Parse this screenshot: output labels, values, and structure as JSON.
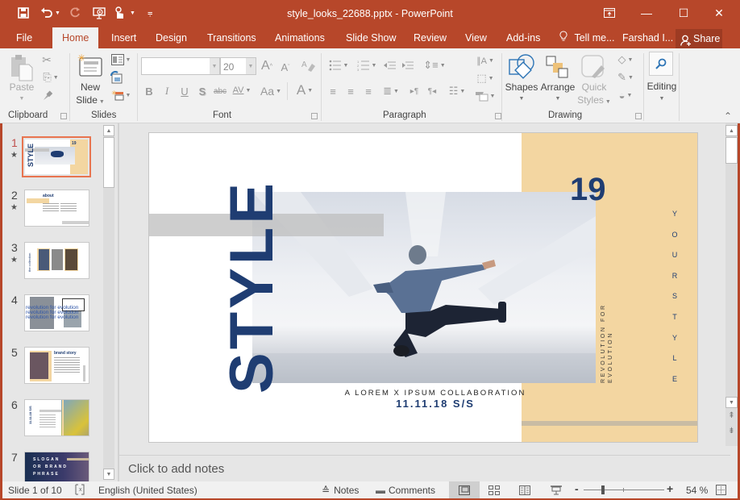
{
  "app": {
    "title": "style_looks_22688.pptx - PowerPoint",
    "accent_color": "#b7472a"
  },
  "quick_access": [
    {
      "name": "save-icon",
      "glyph": "🖫"
    },
    {
      "name": "undo-icon",
      "glyph": "↶"
    },
    {
      "name": "redo-icon",
      "glyph": "↻"
    },
    {
      "name": "start-from-beginning-icon",
      "glyph": "⎚"
    },
    {
      "name": "touch-mode-icon",
      "glyph": "☝"
    },
    {
      "name": "customize-qat-icon",
      "glyph": "⩦"
    }
  ],
  "window_controls": {
    "ribbon_display": "⬒",
    "minimize": "—",
    "maximize": "☐",
    "close": "✕"
  },
  "tabs": [
    {
      "label": "File",
      "active": false
    },
    {
      "label": "Home",
      "active": true
    },
    {
      "label": "Insert",
      "active": false
    },
    {
      "label": "Design",
      "active": false
    },
    {
      "label": "Transitions",
      "active": false
    },
    {
      "label": "Animations",
      "active": false
    },
    {
      "label": "Slide Show",
      "active": false
    },
    {
      "label": "Review",
      "active": false
    },
    {
      "label": "View",
      "active": false
    },
    {
      "label": "Add-ins",
      "active": false
    }
  ],
  "tell_me": "Tell me...",
  "user": "Farshad I...",
  "share": "Share",
  "ribbon": {
    "groups": {
      "clipboard": "Clipboard",
      "slides": "Slides",
      "font": "Font",
      "paragraph": "Paragraph",
      "drawing": "Drawing"
    },
    "paste": "Paste",
    "new_slide": "New",
    "new_slide_2": "Slide",
    "font_name": "",
    "font_size": "20",
    "font_buttons": {
      "bold": "B",
      "italic": "I",
      "underline": "U",
      "shadow": "S",
      "strike": "abc",
      "spacing": "AV",
      "case": "Aa",
      "color": "A",
      "grow": "A",
      "shrink": "A"
    },
    "shapes": "Shapes",
    "arrange": "Arrange",
    "quick": "Quick",
    "styles": "Styles",
    "editing": "Editing"
  },
  "thumbnails": [
    {
      "num": "1",
      "star": true,
      "selected": true
    },
    {
      "num": "2",
      "star": true,
      "selected": false
    },
    {
      "num": "3",
      "star": true,
      "selected": false
    },
    {
      "num": "4",
      "star": false,
      "selected": false
    },
    {
      "num": "5",
      "star": false,
      "selected": false
    },
    {
      "num": "6",
      "star": false,
      "selected": false
    },
    {
      "num": "7",
      "star": false,
      "selected": false
    }
  ],
  "thumb_text": {
    "t1_title": "STYLE",
    "t1_num": "19",
    "t2_title": "about",
    "t3_title": "the collection",
    "t4_line": "revolution for evolution",
    "t5_title": "brand story",
    "t6_title": "11.11.18 S/S",
    "t7_l1": "SLOGAN",
    "t7_l2": "OR BRAND",
    "t7_l3": "PHRASE"
  },
  "slide": {
    "title": "STYLE",
    "number": "19",
    "side_vertical": "YOURSTYLE",
    "side_letters": [
      "Y",
      "O",
      "U",
      "R",
      "S",
      "T",
      "Y",
      "L",
      "E"
    ],
    "tagline_1": "REVOLUTION FOR",
    "tagline_2": "EVOLUTION",
    "collab": "A LOREM X IPSUM COLLABORATION",
    "date": "11.11.18 S/S",
    "colors": {
      "navy": "#1f3d72",
      "sand": "#f3d6a1",
      "gray_bar": "#cfcfcf"
    }
  },
  "notes_placeholder": "Click to add notes",
  "status": {
    "slide_info": "Slide 1 of 10",
    "language": "English (United States)",
    "notes": "Notes",
    "comments": "Comments",
    "zoom_minus": "-",
    "zoom_plus": "+",
    "zoom_level": "54 %",
    "zoom_fraction": 0.54
  }
}
